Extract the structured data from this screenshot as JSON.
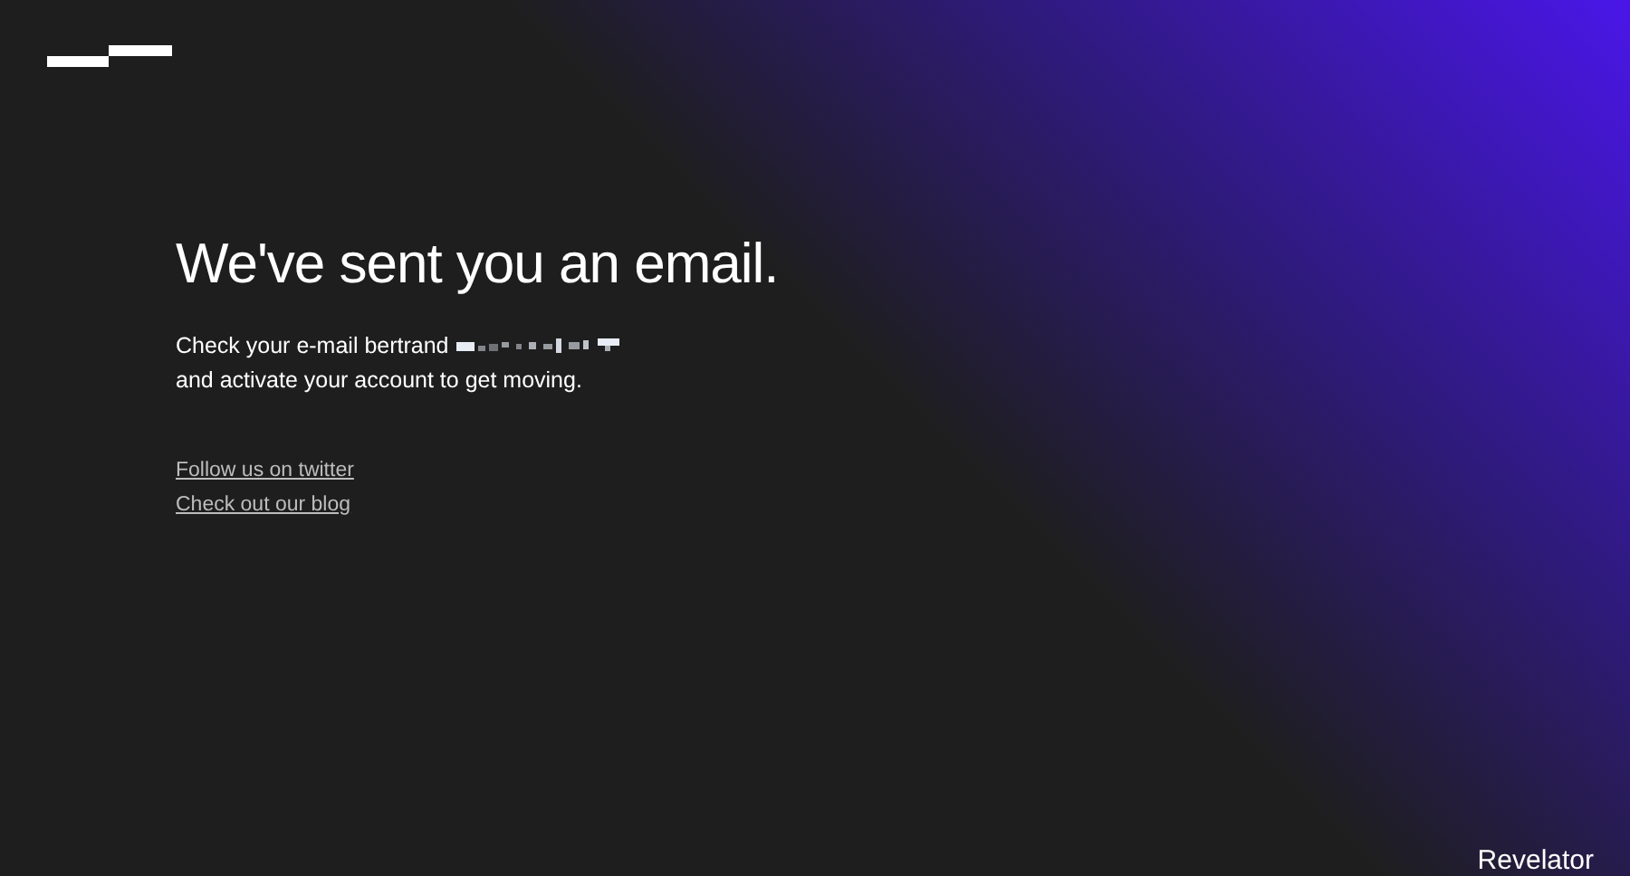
{
  "heading": "We've sent you an email.",
  "message": {
    "line_1": "Check your e-mail bertrand",
    "line_2": "and activate your account to get moving."
  },
  "links": [
    "Follow us on twitter",
    "Check out our blog"
  ],
  "footer_brand": "Revelator"
}
